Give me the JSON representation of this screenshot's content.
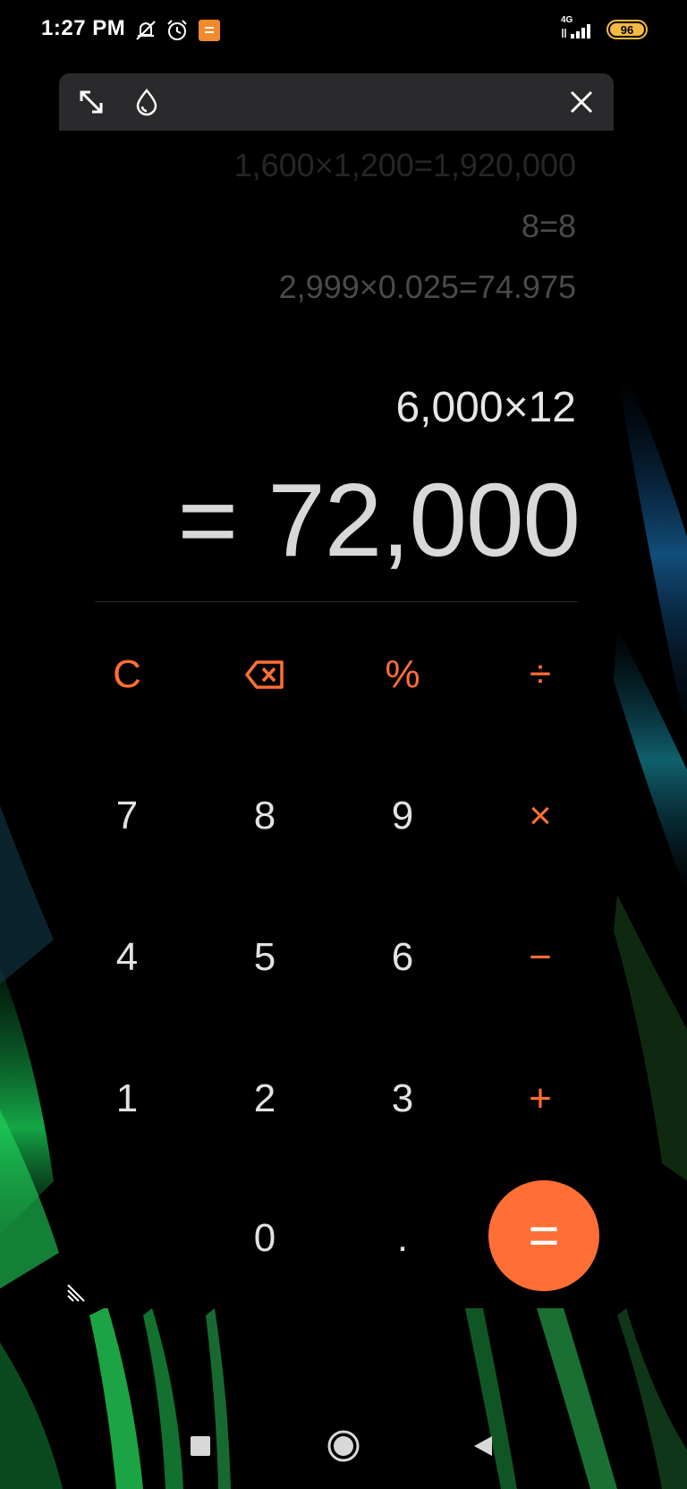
{
  "status_bar": {
    "time": "1:27 PM",
    "network": "4G",
    "battery_level": "96",
    "icons": [
      "mute-notifications-icon",
      "alarm-icon",
      "notes-app-icon",
      "signal-icon",
      "battery-icon"
    ]
  },
  "window_controls": {
    "icons": [
      "expand-icon",
      "opacity-drop-icon",
      "close-icon"
    ]
  },
  "history": [
    "1,600×1,200=1,920,000",
    "8=8",
    "2,999×0.025=74.975"
  ],
  "expression": "6,000×12",
  "result": {
    "equals_sign": "=",
    "value": "72,000"
  },
  "keypad": {
    "clear": "C",
    "backspace": "backspace-icon",
    "percent": "%",
    "divide": "÷",
    "seven": "7",
    "eight": "8",
    "nine": "9",
    "multiply": "×",
    "four": "4",
    "five": "5",
    "six": "6",
    "minus": "−",
    "one": "1",
    "two": "2",
    "three": "3",
    "plus": "+",
    "zero": "0",
    "decimal": ".",
    "equals": "="
  },
  "colors": {
    "accent": "#ff6f35",
    "background": "#000000",
    "titlebar": "#2a2a2c",
    "history_text": "#4a4a4a",
    "result_text": "#d8d8d8",
    "battery": "#f4b942"
  },
  "nav_bar": {
    "icons": [
      "recents-square-icon",
      "home-circle-icon",
      "back-triangle-icon"
    ]
  }
}
